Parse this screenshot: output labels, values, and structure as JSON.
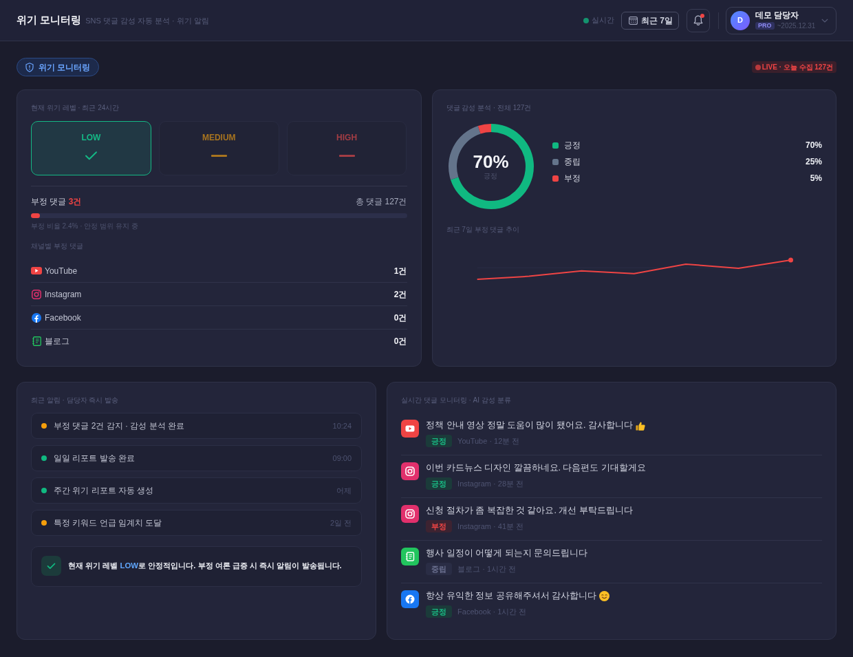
{
  "header": {
    "title": "위기 모니터링",
    "subtitle": "SNS 댓글 감성 자동 분석 · 위기 알림",
    "live_label": "실시간",
    "date_range": "최근 7일",
    "notifications": {
      "unread": true
    },
    "user": {
      "initial": "D",
      "name": "데모 담당자",
      "plan": "PRO",
      "expiry": "~2025.12.31"
    }
  },
  "page_tab": "위기 모니터링",
  "live_badge": "LIVE · 오늘 수집 127건",
  "crisis": {
    "title": "현재 위기 레벨 · 최근 24시간",
    "levels": [
      {
        "label": "LOW",
        "selected": true,
        "color": "#14b985"
      },
      {
        "label": "MEDIUM",
        "selected": false,
        "color": "#a8741f"
      },
      {
        "label": "HIGH",
        "selected": false,
        "color": "#a33d44"
      }
    ],
    "negative_label": "부정 댓글 **3건**",
    "total_label": "총 댓글 127건",
    "negative_share": {
      "level": 0.024
    },
    "ratio_note": "부정 비율 2.4% · 안정 범위 유지 중",
    "channels_title": "채널별 부정 댓글",
    "channels": [
      {
        "kind": "youtube",
        "name": "YouTube",
        "count": "1건"
      },
      {
        "kind": "instagram",
        "name": "Instagram",
        "count": "2건"
      },
      {
        "kind": "facebook",
        "name": "Facebook",
        "count": "0건"
      },
      {
        "kind": "blog",
        "name": "블로그",
        "count": "0건"
      }
    ]
  },
  "sentiment": {
    "title": "댓글 감성 분석 · 전체 127건",
    "chart_data": {
      "type": "donut",
      "categories": [
        "긍정",
        "중립",
        "부정"
      ],
      "values": [
        70,
        25,
        5
      ]
    },
    "center_value": "70%",
    "center_label": "긍정",
    "legend": [
      {
        "value": "70%",
        "color": "#10b981"
      },
      {
        "value": "25%",
        "color": "#64748b"
      },
      {
        "value": "5%",
        "color": "#ef4444"
      }
    ],
    "trend_title": "최근 7일 부정 댓글 추이"
  },
  "alerts": {
    "title": "최근 알림 · 담당자 즉시 발송",
    "items": [
      {
        "text": "부정 댓글 2건 감지 · 감성 분석 완료",
        "time": "10:24",
        "color": "#f59e0b"
      },
      {
        "text": "일일 리포트 발송 완료",
        "time": "09:00",
        "color": "#10b981"
      },
      {
        "text": "주간 위기 리포트 자동 생성",
        "time": "어제",
        "color": "#10b981"
      },
      {
        "text": "특정 키워드 언급 임계치 도달",
        "time": "2일 전",
        "color": "#f59e0b"
      }
    ],
    "notice": "현재 위기 레벨 **LOW**로 안정적입니다. 부정 여론 급증 시 즉시 알림이 발송됩니다."
  },
  "comments": {
    "title": "실시간 댓글 모니터링 · AI 감성 분류",
    "items": [
      {
        "kind": "youtube",
        "text": "정책 안내 영상 정말 도움이 많이 됐어요. 감사합니다",
        "emoji": {
          "kind": "thumbs_up"
        },
        "sentiment": {
          "kind": "positive",
          "label": "긍정"
        },
        "meta": "YouTube · 12분 전"
      },
      {
        "kind": "instagram",
        "text": "이번 카드뉴스 디자인 깔끔하네요. 다음편도 기대할게요",
        "sentiment": {
          "kind": "positive",
          "label": "긍정"
        },
        "meta": "Instagram · 28분 전"
      },
      {
        "kind": "instagram",
        "text": "신청 절차가 좀 복잡한 것 같아요. 개선 부탁드립니다",
        "sentiment": {
          "kind": "negative",
          "label": "부정"
        },
        "meta": "Instagram · 41분 전"
      },
      {
        "kind": "blog",
        "text": "행사 일정이 어떻게 되는지 문의드립니다",
        "sentiment": {
          "kind": "neutral",
          "label": "중립"
        },
        "meta": "블로그 · 1시간 전"
      },
      {
        "kind": "facebook",
        "text": "항상 유익한 정보 공유해주셔서 감사합니다",
        "emoji": {
          "kind": "smile"
        },
        "sentiment": {
          "kind": "positive",
          "label": "긍정"
        },
        "meta": "Facebook · 1시간 전"
      }
    ]
  }
}
